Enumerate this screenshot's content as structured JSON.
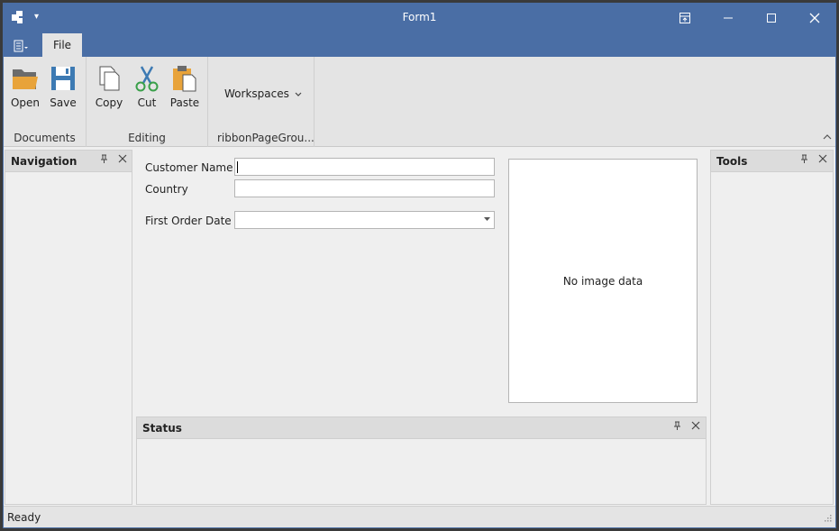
{
  "window": {
    "title": "Form1",
    "qat_dropdown_glyph": "▾"
  },
  "ribbon": {
    "tabs": [
      {
        "label": "File"
      }
    ],
    "groups": [
      {
        "caption": "Documents",
        "buttons": [
          {
            "label": "Open",
            "icon": "folder-open-icon"
          },
          {
            "label": "Save",
            "icon": "floppy-disk-icon"
          }
        ]
      },
      {
        "caption": "Editing",
        "buttons": [
          {
            "label": "Copy",
            "icon": "copy-icon"
          },
          {
            "label": "Cut",
            "icon": "scissors-icon"
          },
          {
            "label": "Paste",
            "icon": "clipboard-paste-icon"
          }
        ]
      },
      {
        "caption": "ribbonPageGrou...",
        "buttons": [
          {
            "label": "Workspaces",
            "icon": "chevron-down-icon"
          }
        ]
      }
    ]
  },
  "panels": {
    "navigation": {
      "title": "Navigation"
    },
    "tools": {
      "title": "Tools"
    },
    "status": {
      "title": "Status"
    }
  },
  "form": {
    "customer_name": {
      "label": "Customer Name",
      "value": ""
    },
    "country": {
      "label": "Country",
      "value": ""
    },
    "first_order_date": {
      "label": "First Order Date",
      "value": ""
    },
    "image": {
      "placeholder": "No image data"
    }
  },
  "statusbar": {
    "text": "Ready"
  },
  "colors": {
    "title_bar": "#4a6ea5",
    "ribbon": "#e4e4e4",
    "panel_header": "#dcdcdc",
    "folder": "#e8a33a"
  }
}
